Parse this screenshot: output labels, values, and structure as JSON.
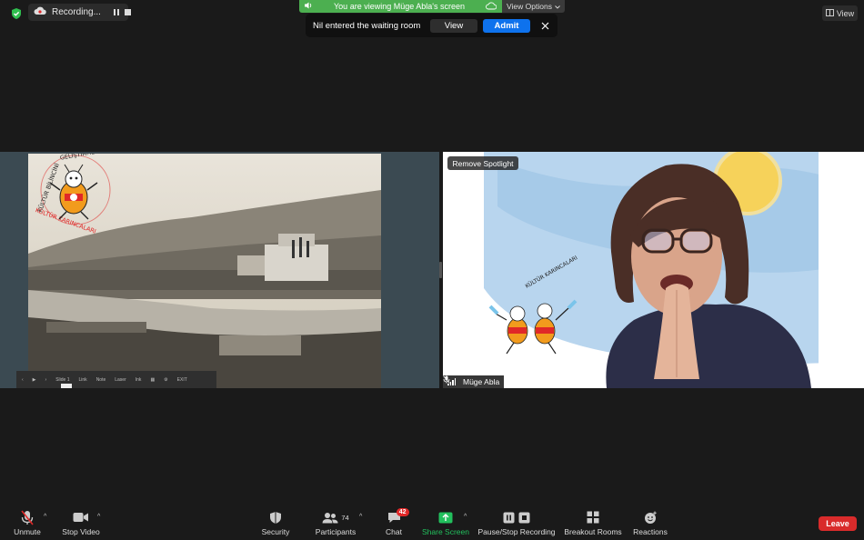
{
  "recording": {
    "label": "Recording..."
  },
  "banner": {
    "viewing_text": "You are viewing Müge Abla's screen",
    "view_options": "View Options"
  },
  "waiting": {
    "message": "Nil entered the waiting room",
    "view_label": "View",
    "admit_label": "Admit"
  },
  "view_button": {
    "label": "View"
  },
  "shared_screen": {
    "logo_text_top": "KÜLTÜR BİLİNCİNİ GELİŞTİRME VAKFI",
    "logo_text_bottom": "KÜLTÜR KARINCALARI",
    "slide_toolbar": {
      "slide_label": "Slide 1",
      "labels": [
        "Link",
        "Note",
        "Laser",
        "Ink"
      ],
      "exit_label": "EXIT"
    }
  },
  "video": {
    "spotlight_label": "Remove Spotlight",
    "participant_name": "Müge Abla",
    "poster_text": "KÜLTÜR KARINCALARI"
  },
  "toolbar": {
    "unmute": "Unmute",
    "stop_video": "Stop Video",
    "security": "Security",
    "participants": "Participants",
    "participants_count": "74",
    "chat": "Chat",
    "chat_badge": "42",
    "share_screen": "Share Screen",
    "recording": "Pause/Stop Recording",
    "breakout": "Breakout Rooms",
    "reactions": "Reactions",
    "leave": "Leave"
  },
  "colors": {
    "accent_green": "#4caf50",
    "admit_blue": "#0e72ed",
    "leave_red": "#d92b2b",
    "share_green": "#22c05d"
  }
}
